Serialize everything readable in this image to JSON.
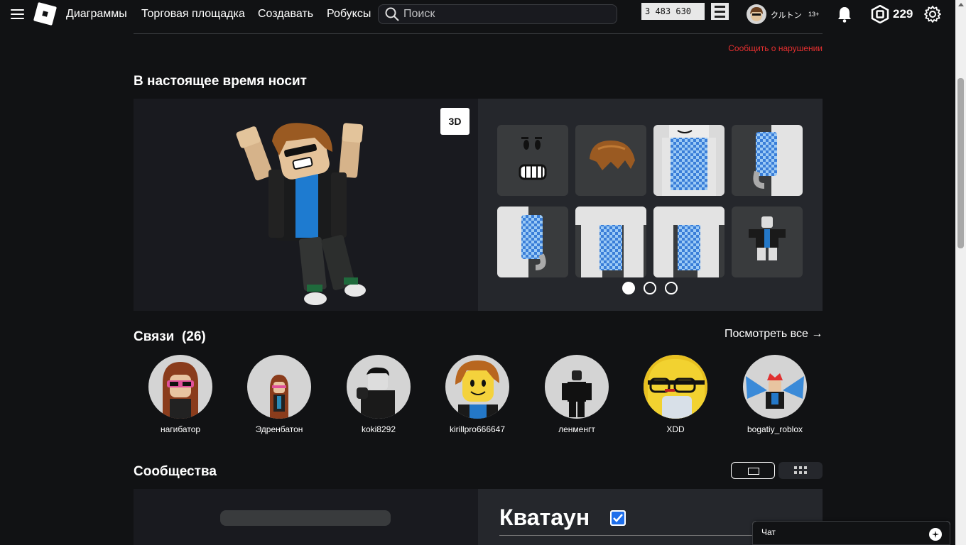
{
  "nav": {
    "links": [
      "Диаграммы",
      "Торговая площадка",
      "Создавать",
      "Робуксы"
    ],
    "search_placeholder": "Поиск",
    "counter": "3 483 630",
    "username": "クルトン",
    "age_badge": "13+",
    "robux": "229"
  },
  "report_link": "Сообщить о нарушении",
  "wearing": {
    "title": "В настоящее время носит",
    "btn_3d": "3D",
    "items": [
      "face",
      "hair",
      "shirt-torso",
      "right-arm",
      "left-arm",
      "right-leg",
      "left-leg",
      "outfit"
    ],
    "page_count": 3,
    "active_page": 0
  },
  "connections": {
    "title": "Связи",
    "count": "(26)",
    "see_all": "Посмотреть все",
    "friends": [
      {
        "name": "нагибатор"
      },
      {
        "name": "Эдренбатон"
      },
      {
        "name": "koki8292"
      },
      {
        "name": "kirillpro666647"
      },
      {
        "name": "ленменгт"
      },
      {
        "name": "XDD"
      },
      {
        "name": "bogatiy_roblox"
      }
    ]
  },
  "communities": {
    "title": "Сообщества",
    "featured_name": "Кватаун"
  },
  "chat": {
    "label": "Чат"
  },
  "colors": {
    "background": "#111214",
    "panel": "#191a1f",
    "panel_alt": "#25272c",
    "report": "#e52f2f",
    "verified": "#1f6feb"
  }
}
